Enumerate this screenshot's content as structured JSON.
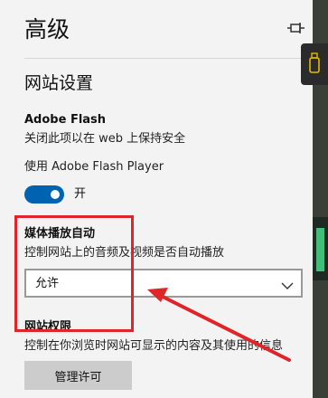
{
  "header": {
    "title": "高级"
  },
  "website_settings": {
    "title": "网站设置"
  },
  "flash": {
    "title": "Adobe Flash",
    "description": "关闭此项以在 web 上保持安全",
    "use_label": "使用 Adobe Flash Player",
    "toggle_state": "开",
    "toggle_on": true
  },
  "media_autoplay": {
    "title": "媒体播放自动",
    "description": "控制网站上的音频及视频是否自动播放",
    "selected_option": "允许"
  },
  "site_permissions": {
    "title": "网站权限",
    "description": "控制在你浏览时网站可显示的内容及其使用的信息",
    "manage_button": "管理许可"
  },
  "icons": {
    "pin": "pin-icon",
    "dropdown": "chevron-down-icon",
    "edge_tab": "usb-icon"
  },
  "colors": {
    "panel_background": "#f3f3f3",
    "toggle_on": "#0063b1",
    "annotation_red": "#e0252a",
    "button_background": "#cccccc"
  }
}
